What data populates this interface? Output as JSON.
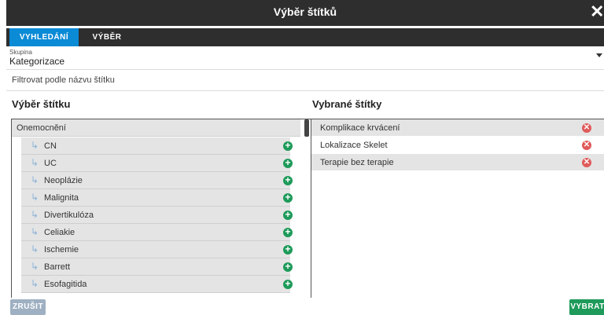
{
  "dialog": {
    "title": "Výběr štítků"
  },
  "tabs": [
    {
      "label": "VYHLEDÁNÍ",
      "active": true
    },
    {
      "label": "VÝBĚR",
      "active": false
    }
  ],
  "group_select": {
    "label": "Skupina",
    "value": "Kategorizace"
  },
  "filter": {
    "placeholder": "Filtrovat podle názvu štítku",
    "value": ""
  },
  "left_panel": {
    "heading": "Výběr štítku",
    "group": "Onemocnění",
    "items": [
      {
        "label": "CN"
      },
      {
        "label": "UC"
      },
      {
        "label": "Neoplázie"
      },
      {
        "label": "Malignita"
      },
      {
        "label": "Divertikulóza"
      },
      {
        "label": "Celiakie"
      },
      {
        "label": "Ischemie"
      },
      {
        "label": "Barrett"
      },
      {
        "label": "Esofagitida"
      }
    ]
  },
  "right_panel": {
    "heading": "Vybrané štítky",
    "items": [
      {
        "label": "Komplikace krvácení"
      },
      {
        "label": "Lokalizace Skelet"
      },
      {
        "label": "Terapie bez terapie"
      }
    ]
  },
  "icons": {
    "arrow": "subitem-arrow-icon",
    "add": "plus-circle-icon",
    "remove": "x-circle-icon",
    "close": "close-icon"
  },
  "colors": {
    "accent": "#0b8ad6",
    "add": "#1e9a5a",
    "remove": "#e05a5a",
    "titlebar": "#2e2e2e"
  },
  "buttons": {
    "cancel": "ZRUŠIT",
    "select": "VYBRAT"
  }
}
